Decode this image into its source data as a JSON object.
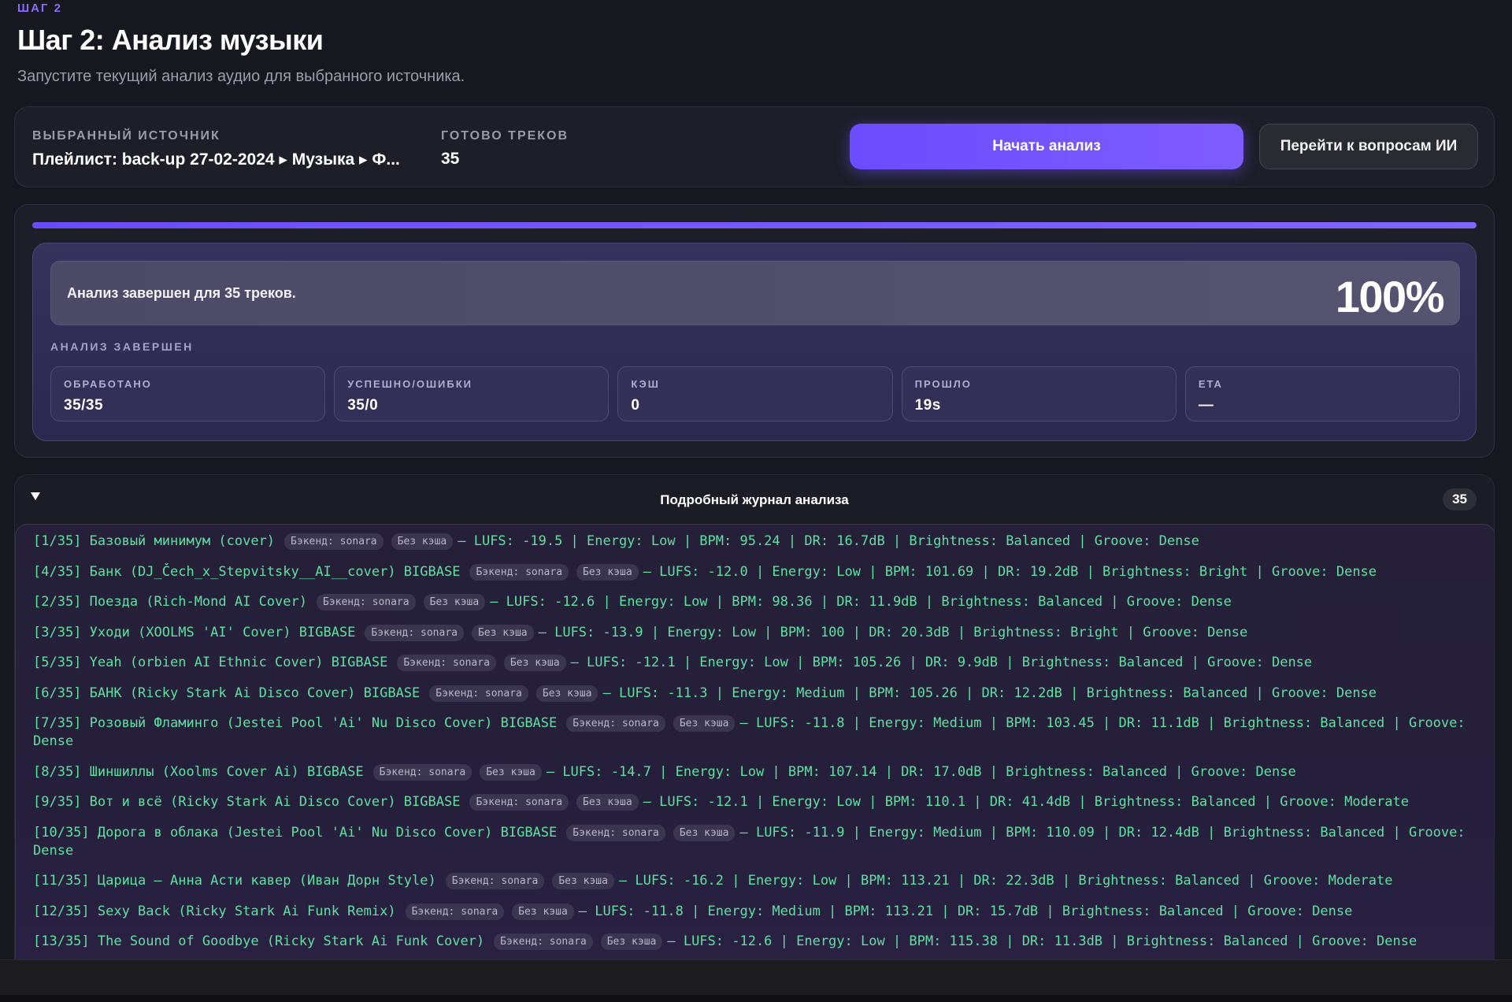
{
  "header": {
    "step_tag": "ШАГ 2",
    "title": "Шаг 2: Анализ музыки",
    "subtitle": "Запустите текущий анализ аудио для выбранного источника."
  },
  "source": {
    "selected_label": "ВЫБРАННЫЙ ИСТОЧНИК",
    "selected_value": "Плейлист: back-up 27-02-2024 ▸ Музыка ▸ Ф...",
    "ready_label": "ГОТОВО ТРЕКОВ",
    "ready_value": "35",
    "start_button": "Начать анализ",
    "ai_button": "Перейти к вопросам ИИ"
  },
  "progress": {
    "fraction": 1.0,
    "status_text": "Анализ завершен для 35 треков.",
    "percent": "100%",
    "state_label": "АНАЛИЗ ЗАВЕРШЕН",
    "stats": [
      {
        "label": "ОБРАБОТАНО",
        "value": "35/35"
      },
      {
        "label": "УСПЕШНО/ОШИБКИ",
        "value": "35/0"
      },
      {
        "label": "КЭШ",
        "value": "0"
      },
      {
        "label": "ПРОШЛО",
        "value": "19s"
      },
      {
        "label": "ETA",
        "value": "—"
      }
    ]
  },
  "log": {
    "title": "Подробный журнал анализа",
    "count": "35",
    "entries": [
      {
        "head": "[1/35] Базовый минимум (cover)",
        "backend": "Бэкенд: sonara",
        "cache": "Без кэша",
        "tail": "— LUFS: -19.5 | Energy: Low | BPM: 95.24 | DR: 16.7dB | Brightness: Balanced | Groove: Dense"
      },
      {
        "head": "[4/35] Банк (DJ_Čech_x_Stepvitsky__AI__cover) BIGBASE",
        "backend": "Бэкенд: sonara",
        "cache": "Без кэша",
        "tail": "— LUFS: -12.0 | Energy: Low | BPM: 101.69 | DR: 19.2dB | Brightness: Bright | Groove: Dense"
      },
      {
        "head": "[2/35] Поезда (Rich-Mond AI Cover)",
        "backend": "Бэкенд: sonara",
        "cache": "Без кэша",
        "tail": "— LUFS: -12.6 | Energy: Low | BPM: 98.36 | DR: 11.9dB | Brightness: Balanced | Groove: Dense"
      },
      {
        "head": "[3/35] Уходи (XOOLMS 'AI' Cover) BIGBASE",
        "backend": "Бэкенд: sonara",
        "cache": "Без кэша",
        "tail": "— LUFS: -13.9 | Energy: Low | BPM: 100 | DR: 20.3dB | Brightness: Bright | Groove: Dense"
      },
      {
        "head": "[5/35] Yeah (orbien AI Ethnic Cover) BIGBASE",
        "backend": "Бэкенд: sonara",
        "cache": "Без кэша",
        "tail": "— LUFS: -12.1 | Energy: Low | BPM: 105.26 | DR: 9.9dB | Brightness: Balanced | Groove: Dense"
      },
      {
        "head": "[6/35] БАНК (Ricky Stark Ai Disco Cover) BIGBASE",
        "backend": "Бэкенд: sonara",
        "cache": "Без кэша",
        "tail": "— LUFS: -11.3 | Energy: Medium | BPM: 105.26 | DR: 12.2dB | Brightness: Balanced | Groove: Dense"
      },
      {
        "head": "[7/35] Розовый Фламинго (Jestei Pool 'Ai' Nu Disco Cover) BIGBASE",
        "backend": "Бэкенд: sonara",
        "cache": "Без кэша",
        "tail": "— LUFS: -11.8 | Energy: Medium | BPM: 103.45 | DR: 11.1dB | Brightness: Balanced | Groove: Dense"
      },
      {
        "head": "[8/35] Шиншиллы (Xoolms Cover Ai) BIGBASE",
        "backend": "Бэкенд: sonara",
        "cache": "Без кэша",
        "tail": "— LUFS: -14.7 | Energy: Low | BPM: 107.14 | DR: 17.0dB | Brightness: Balanced | Groove: Dense"
      },
      {
        "head": "[9/35] Вот и всё (Ricky Stark Ai Disco Cover) BIGBASE",
        "backend": "Бэкенд: sonara",
        "cache": "Без кэша",
        "tail": "— LUFS: -12.1 | Energy: Low | BPM: 110.1 | DR: 41.4dB | Brightness: Balanced | Groove: Moderate"
      },
      {
        "head": "[10/35] Дорога в облака (Jestei Pool 'Ai' Nu Disco Cover) BIGBASE",
        "backend": "Бэкенд: sonara",
        "cache": "Без кэша",
        "tail": "— LUFS: -11.9 | Energy: Medium | BPM: 110.09 | DR: 12.4dB | Brightness: Balanced | Groove: Dense"
      },
      {
        "head": "[11/35] Царица – Анна Асти кавер (Иван Дорн Style)",
        "backend": "Бэкенд: sonara",
        "cache": "Без кэша",
        "tail": "— LUFS: -16.2 | Energy: Low | BPM: 113.21 | DR: 22.3dB | Brightness: Balanced | Groove: Moderate"
      },
      {
        "head": "[12/35] Sexy Back (Ricky Stark Ai Funk Remix)",
        "backend": "Бэкенд: sonara",
        "cache": "Без кэша",
        "tail": "— LUFS: -11.8 | Energy: Medium | BPM: 113.21 | DR: 15.7dB | Brightness: Balanced | Groove: Dense"
      },
      {
        "head": "[13/35] The Sound of Goodbye (Ricky Stark Ai Funk Cover)",
        "backend": "Бэкенд: sonara",
        "cache": "Без кэша",
        "tail": "— LUFS: -12.6 | Energy: Low | BPM: 115.38 | DR: 11.3dB | Brightness: Balanced | Groove: Dense"
      }
    ]
  }
}
